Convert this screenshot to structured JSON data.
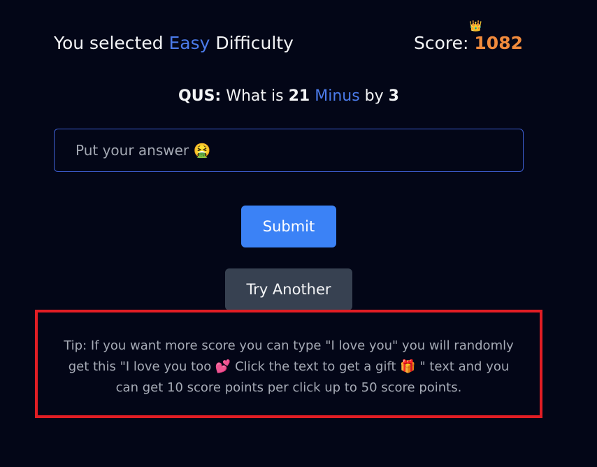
{
  "header": {
    "prefix": "You selected ",
    "difficulty": "Easy",
    "suffix": " Difficulty"
  },
  "score": {
    "label": "Score: ",
    "crown_icon": "crown-icon",
    "value": "1082",
    "value_color": "#f08a3c"
  },
  "question": {
    "label": "QUS:",
    "text_before": " What is ",
    "num1": "21",
    "operation": "Minus",
    "text_mid": " by ",
    "num2": "3"
  },
  "answer": {
    "placeholder": "Put your answer 🤮",
    "value": ""
  },
  "buttons": {
    "submit": "Submit",
    "try_another": "Try Another"
  },
  "tip": {
    "line1": "Tip: If you want more score you can type \"I love you\" you will randomly",
    "line2": "get this \"I love you too 💕  Click the text to get a gift 🎁 \" text and you",
    "line3": "can get 10 score points per click up to 50 score points."
  },
  "colors": {
    "background": "#030617",
    "accent_blue": "#4b7bea",
    "submit_bg": "#3b82f6",
    "try_bg": "#374151",
    "highlight_border": "#e11d24"
  }
}
